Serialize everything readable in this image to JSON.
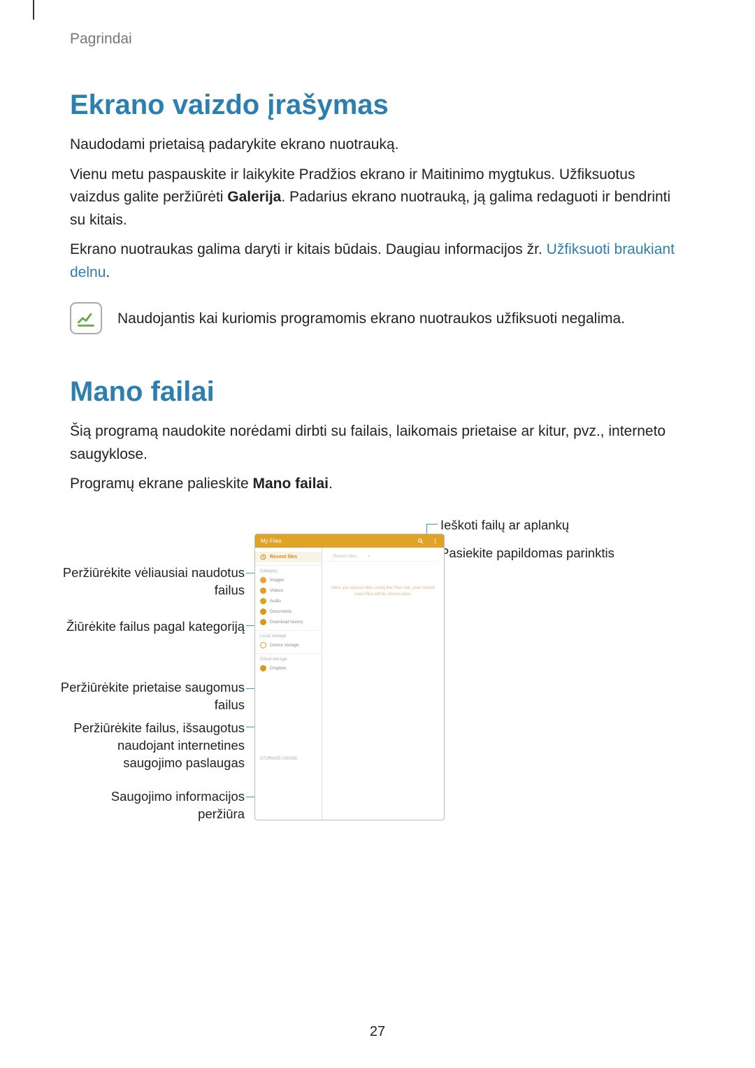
{
  "header": {
    "section": "Pagrindai"
  },
  "sec1": {
    "title": "Ekrano vaizdo įrašymas",
    "p1": "Naudodami prietaisą padarykite ekrano nuotrauką.",
    "p2a": "Vienu metu paspauskite ir laikykite Pradžios ekrano ir Maitinimo mygtukus. Užfiksuotus vaizdus galite peržiūrėti ",
    "p2b_bold": "Galerija",
    "p2c": ". Padarius ekrano nuotrauką, ją galima redaguoti ir bendrinti su kitais.",
    "p3a": "Ekrano nuotraukas galima daryti ir kitais būdais. Daugiau informacijos žr. ",
    "p3_link": "Užfiksuoti braukiant delnu",
    "p3b": ".",
    "note": "Naudojantis kai kuriomis programomis ekrano nuotraukos užfiksuoti negalima."
  },
  "sec2": {
    "title": "Mano failai",
    "p1": "Šią programą naudokite norėdami dirbti su failais, laikomais prietaise ar kitur, pvz., interneto saugyklose.",
    "p2a": "Programų ekrane palieskite ",
    "p2b_bold": "Mano failai",
    "p2c": "."
  },
  "callouts": {
    "left1": "Peržiūrėkite vėliausiai naudotus\nfailus",
    "left2": "Žiūrėkite failus pagal kategoriją",
    "left3": "Peržiūrėkite prietaise saugomus\nfailus",
    "left4": "Peržiūrėkite failus, išsaugotus\nnaudojant internetines\nsaugojimo paslaugas",
    "left5": "Saugojimo informacijos\nperžiūra",
    "right1": "Ieškoti failų ar aplankų",
    "right2": "Pasiekite papildomas parinktis"
  },
  "tablet": {
    "title": "My Files",
    "recent": "Recent files",
    "catLabel": "Category",
    "cat": [
      "Images",
      "Videos",
      "Audio",
      "Documents",
      "Download history"
    ],
    "localLabel": "Local storage",
    "local": "Device storage",
    "cloudLabel": "Cloud storage",
    "cloud1": "Dropbox",
    "cloud2": " ",
    "tab1": "Recent files",
    "plus": "+",
    "msg": "Here you access files using the Files bar,\nyour recent used files will be shown here.",
    "storage": "STORAGE USAGE"
  },
  "pageNumber": "27"
}
